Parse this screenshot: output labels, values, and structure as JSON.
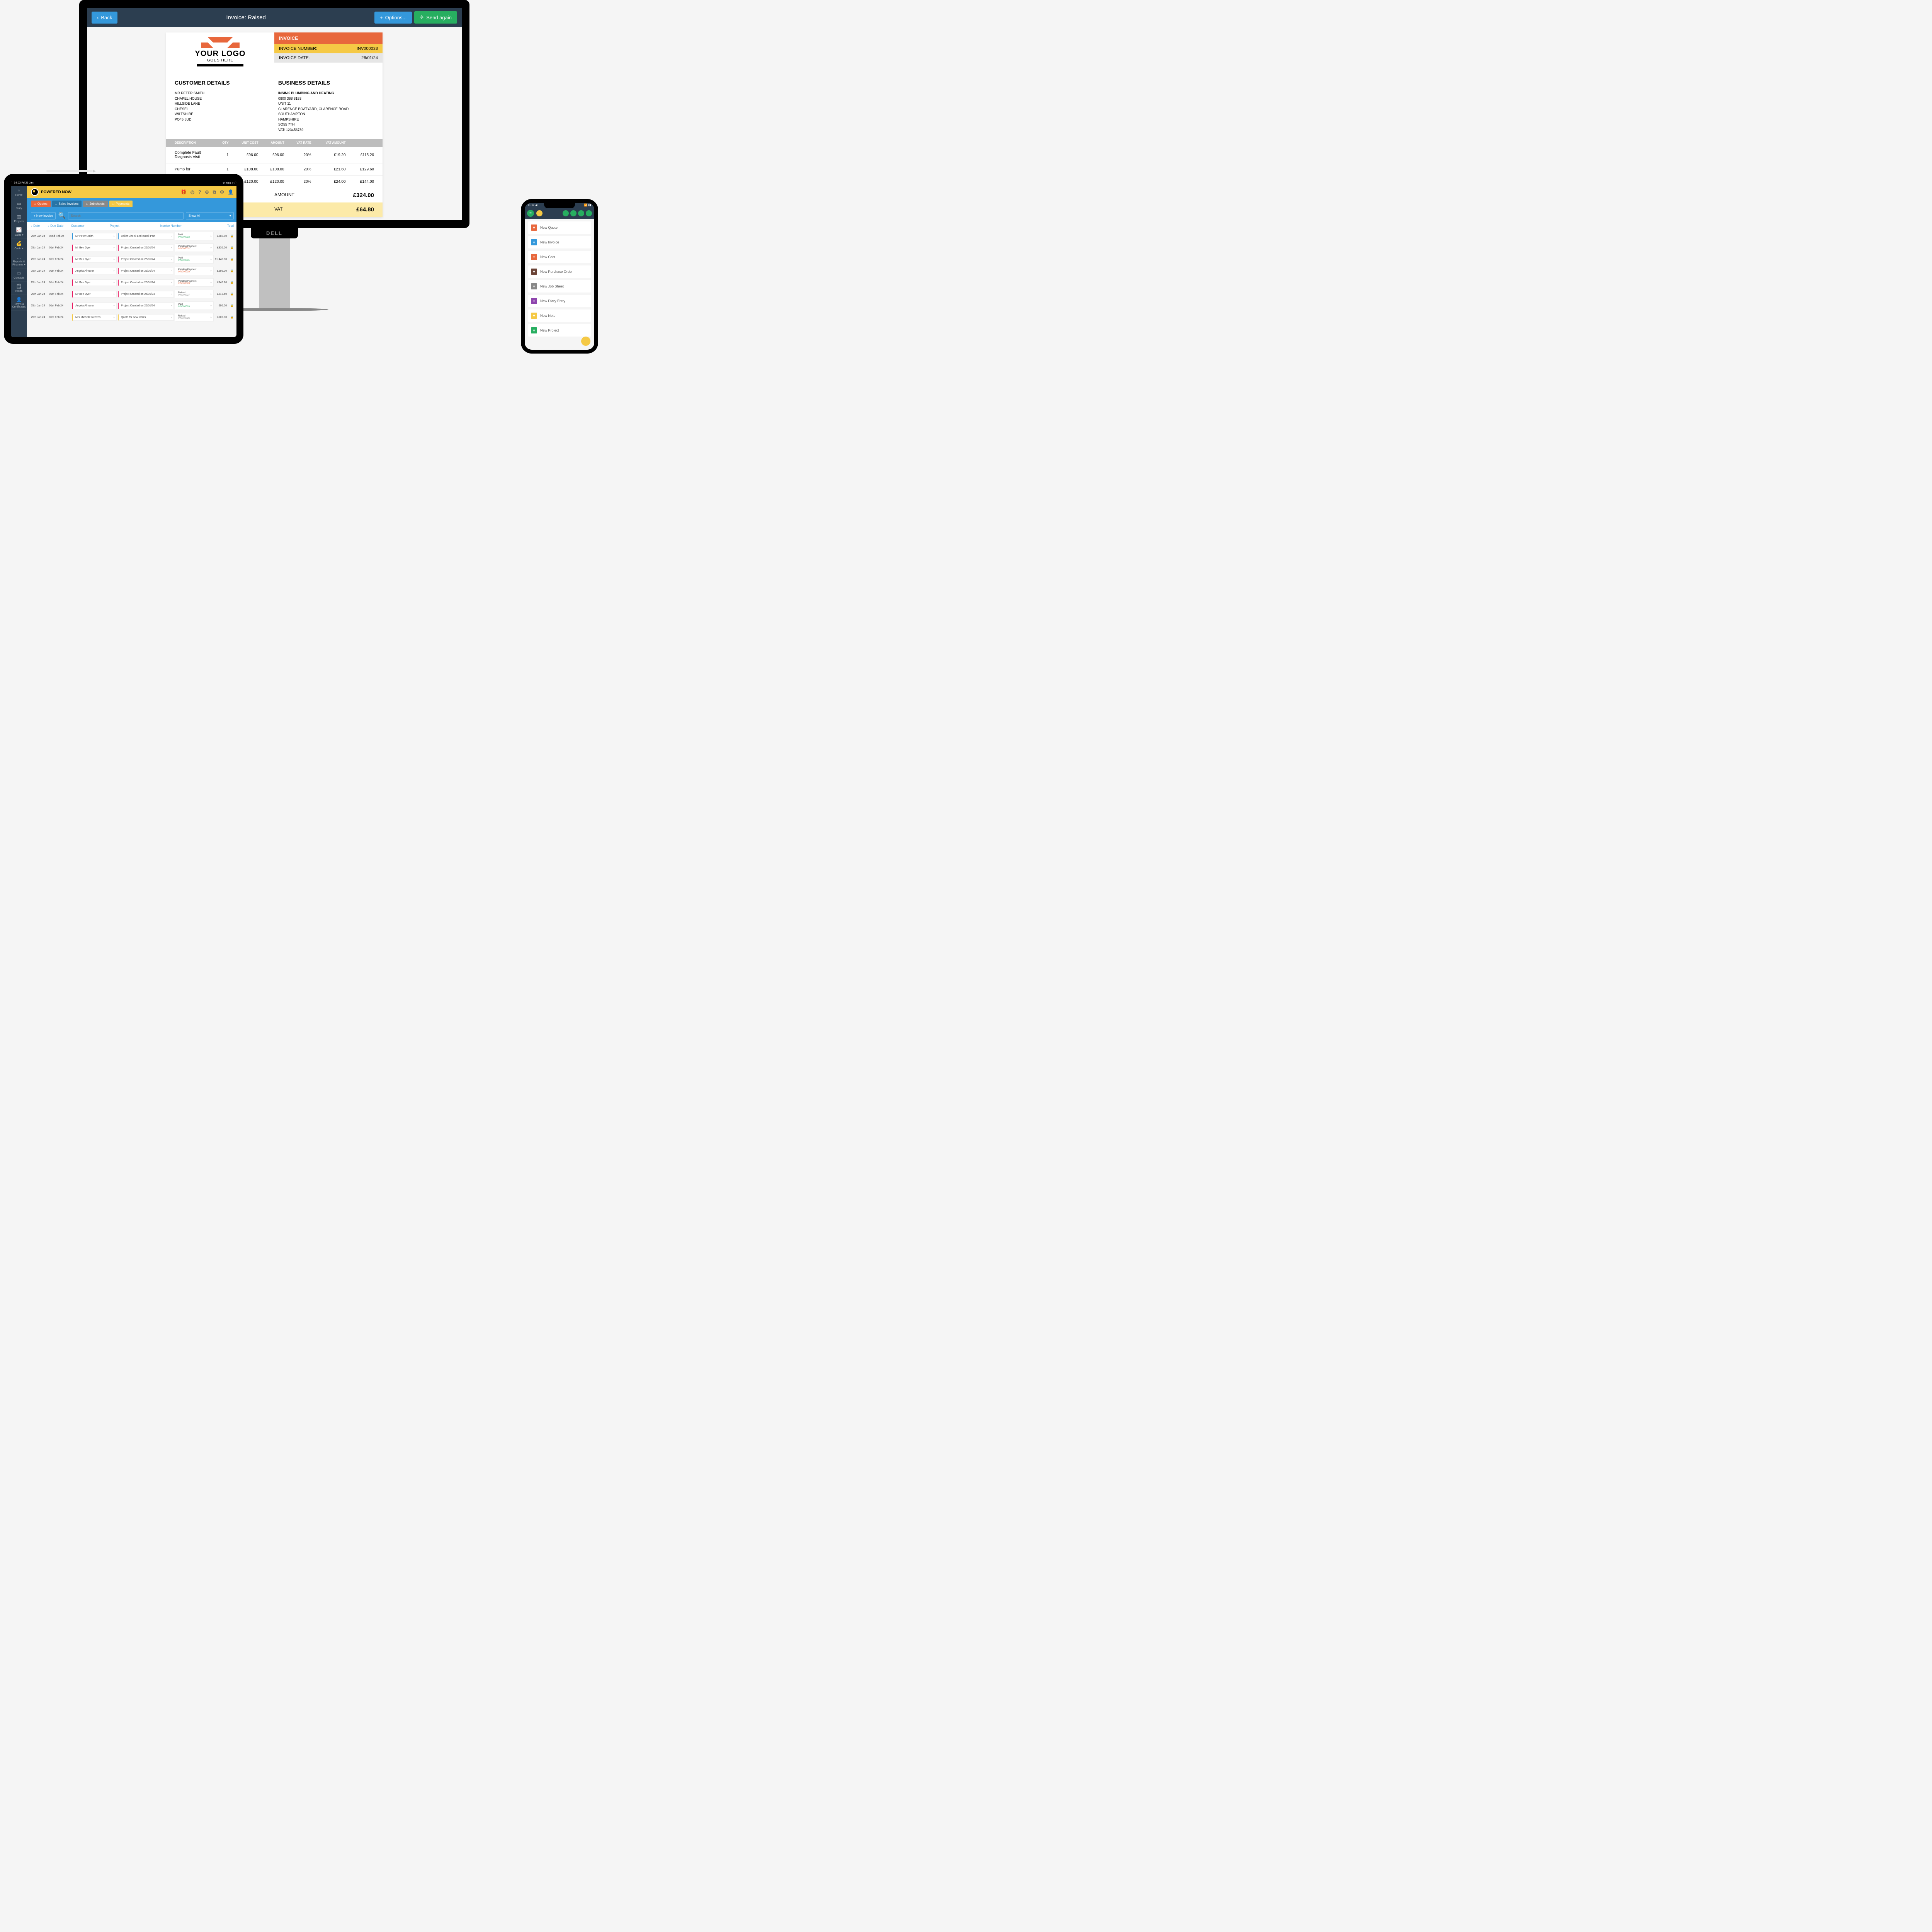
{
  "monitor": {
    "back_label": "Back",
    "title": "Invoice: Raised",
    "options_label": "Options...",
    "send_label": "Send again",
    "stand_brand": "DELL"
  },
  "invoice": {
    "logo_line1": "YOUR LOGO",
    "logo_line2": "GOES HERE",
    "heading": "INVOICE",
    "number_label": "INVOICE NUMBER:",
    "number_value": "INV000033",
    "date_label": "INVOICE DATE:",
    "date_value": "26/01/24",
    "customer_heading": "CUSTOMER DETAILS",
    "business_heading": "BUSINESS DETAILS",
    "customer": [
      "MR PETER SMITH",
      "CHAPEL HOUSE",
      "HILLSIDE LANE",
      "CHESEL",
      "WILTSHIRE",
      "PO45 5UD"
    ],
    "business": [
      "INSINK PLUMBING AND HEATING",
      "0800 368 8153",
      "UNIT 11",
      "CLARENCE BOATYARD, CLARENCE ROAD",
      "SOUTHAMPTON",
      "HAMPSHIRE",
      "SO55 7TH",
      "VAT: 123456789"
    ],
    "cols": [
      "DESCRIPTION",
      "QTY",
      "UNIT COST",
      "AMOUNT",
      "VAT RATE",
      "VAT AMOUNT",
      ""
    ],
    "lines": [
      {
        "desc": "Complete Fault Diagnosis Visit",
        "qty": "1",
        "unit": "£96.00",
        "amt": "£96.00",
        "rate": "20%",
        "vat": "£19.20",
        "tot": "£115.20"
      },
      {
        "desc": "Pump for",
        "qty": "1",
        "unit": "£108.00",
        "amt": "£108.00",
        "rate": "20%",
        "vat": "£21.60",
        "tot": "£129.60"
      },
      {
        "desc": "",
        "qty": "",
        "unit": "£120.00",
        "amt": "£120.00",
        "rate": "20%",
        "vat": "£24.00",
        "tot": "£144.00"
      }
    ],
    "amount_label": "AMOUNT",
    "amount_value": "£324.00",
    "vat_label": "VAT",
    "vat_value": "£64.80"
  },
  "tablet": {
    "status_left": "14:03   Fri 26 Jan",
    "status_right": "⋯  ᯤ 50% ▢",
    "brand": "POWERED NOW",
    "nav": [
      {
        "icon": "⌂",
        "label": "Home"
      },
      {
        "icon": "▭",
        "label": "Diary"
      },
      {
        "icon": "▥",
        "label": "Projects"
      },
      {
        "icon": "📈",
        "label": "Sales ▾"
      },
      {
        "icon": "💰",
        "label": "Costs ▾"
      },
      {
        "icon": "…",
        "label": "Reports & Finances ▾"
      },
      {
        "icon": "▭",
        "label": "Contacts"
      },
      {
        "icon": "🗒",
        "label": "Notes"
      },
      {
        "icon": "👤",
        "label": "Forms & Certificates"
      }
    ],
    "tabs": [
      {
        "cls": "r",
        "icon": "□",
        "label": "Quotes"
      },
      {
        "cls": "b",
        "icon": "□",
        "label": "Sales Invoices"
      },
      {
        "cls": "g",
        "icon": "□",
        "label": "Job sheets"
      },
      {
        "cls": "y",
        "icon": "□",
        "label": "Payments"
      }
    ],
    "new_btn": "+ New Invoice",
    "search_placeholder": "Search",
    "filter": "Show All",
    "headers": [
      "↓ Date",
      "↓ Due Date",
      "Customer",
      "Project",
      "Invoice Number",
      "Total"
    ],
    "rows": [
      {
        "date": "26th Jan 24",
        "due": "02nd Feb 24",
        "cust": "Mr Peter Smith",
        "c": "#3498db",
        "proj": "Boiler Check and Install Part",
        "status": "Paid",
        "inv": "INV000033",
        "sc": "#27ae60",
        "total": "£388.80"
      },
      {
        "date": "25th Jan 24",
        "due": "01st Feb 24",
        "cust": "Mr Ben Dyer",
        "c": "#e91e63",
        "proj": "Project Created on 25/01/24",
        "status": "Pending Payment",
        "inv": "INV000032",
        "sc": "#e8673c",
        "total": "£936.00"
      },
      {
        "date": "25th Jan 24",
        "due": "01st Feb 24",
        "cust": "Mr Ben Dyer",
        "c": "#e91e63",
        "proj": "Project Created on 25/01/24",
        "status": "Paid",
        "inv": "INV000031",
        "sc": "#27ae60",
        "total": "£1,440.00"
      },
      {
        "date": "25th Jan 24",
        "due": "01st Feb 24",
        "cust": "Angela Almaron",
        "c": "#e91e63",
        "proj": "Project Created on 25/01/24",
        "status": "Pending Payment",
        "inv": "INV000030",
        "sc": "#e8673c",
        "total": "£696.00"
      },
      {
        "date": "25th Jan 24",
        "due": "01st Feb 24",
        "cust": "Mr Ben Dyer",
        "c": "#e91e63",
        "proj": "Project Created on 25/01/24",
        "status": "Pending Payment",
        "inv": "INV000028",
        "sc": "#e8673c",
        "total": "£946.80"
      },
      {
        "date": "25th Jan 24",
        "due": "01st Feb 24",
        "cust": "Mr Ben Dyer",
        "c": "#e91e63",
        "proj": "Project Created on 25/01/24",
        "status": "Raised",
        "inv": "INV000027",
        "sc": "#888",
        "total": "£813.60"
      },
      {
        "date": "25th Jan 24",
        "due": "01st Feb 24",
        "cust": "Angela Almaron",
        "c": "#e91e63",
        "proj": "Project Created on 25/01/24",
        "status": "Paid",
        "inv": "INV000026",
        "sc": "#27ae60",
        "total": "£96.00"
      },
      {
        "date": "25th Jan 24",
        "due": "01st Feb 24",
        "cust": "Mrs Michelle Reeves",
        "c": "#f5c945",
        "proj": "Quote for new works",
        "status": "Raised",
        "inv": "INV000026",
        "sc": "#888",
        "total": "£102.00"
      }
    ]
  },
  "phone": {
    "status_left": "11:17 ◀",
    "status_right": "📶  ▮▮",
    "items": [
      {
        "color": "#e8673c",
        "label": "New Quote"
      },
      {
        "color": "#3498db",
        "label": "New Invoice"
      },
      {
        "color": "#e8673c",
        "label": "New Cost"
      },
      {
        "color": "#6b4336",
        "label": "New Purchase Order"
      },
      {
        "color": "#888888",
        "label": "New Job Sheet"
      },
      {
        "color": "#8e44ad",
        "label": "New Diary Entry"
      },
      {
        "color": "#f5c945",
        "label": "New Note"
      },
      {
        "color": "#27ae60",
        "label": "New Project"
      }
    ]
  }
}
